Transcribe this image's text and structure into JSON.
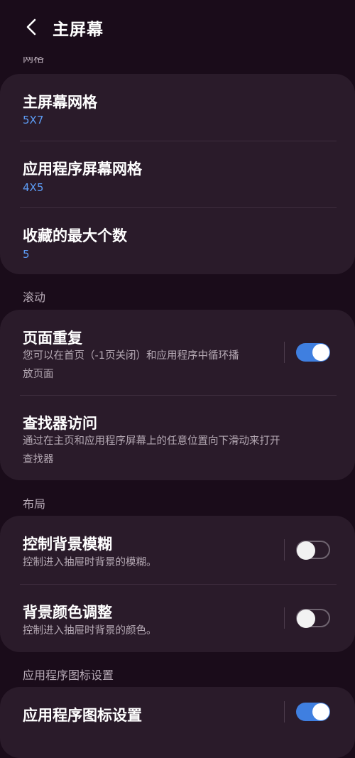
{
  "header": {
    "title": "主屏幕",
    "back_icon": "chevron-left-icon"
  },
  "sections": {
    "grid_label_clipped": "网格",
    "scroll": "滚动",
    "layout": "布局",
    "app_icon": "应用程序图标设置"
  },
  "grid": {
    "home_grid": {
      "title": "主屏幕网格",
      "value": "5X7"
    },
    "app_grid": {
      "title": "应用程序屏幕网格",
      "value": "4X5"
    },
    "max_favorites": {
      "title": "收藏的最大个数",
      "value": "5"
    }
  },
  "scroll": {
    "page_loop": {
      "title": "页面重复",
      "desc_line1": "您可以在首页（-1页关闭）和应用程序中循环播",
      "desc_line2": "放页面",
      "enabled": true
    },
    "finder_access": {
      "title": "查找器访问",
      "desc_line1": "通过在主页和应用程序屏幕上的任意位置向下滑动来打开",
      "desc_line2": "查找器"
    }
  },
  "layout": {
    "bg_blur": {
      "title": "控制背景模糊",
      "desc": "控制进入抽屉时背景的模糊。",
      "enabled": false
    },
    "bg_color": {
      "title": "背景颜色调整",
      "desc": "控制进入抽屉时背景的颜色。",
      "enabled": false
    }
  },
  "app_icon": {
    "settings": {
      "title": "应用程序图标设置",
      "enabled": true
    }
  },
  "colors": {
    "accent": "#3f7fe0",
    "value_blue": "#5d9cf5",
    "card": "#2a1b2a",
    "background": "#1a0c1a"
  }
}
